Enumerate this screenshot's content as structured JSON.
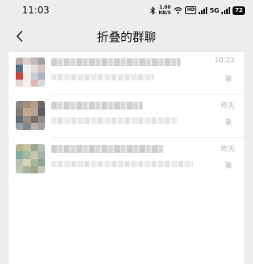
{
  "status_bar": {
    "time": "11:03",
    "net_speed_value": "1.00",
    "net_speed_unit": "KB/S",
    "hd_label": "HD",
    "signal_label": "5G",
    "battery_level": "72"
  },
  "header": {
    "title": "折叠的群聊"
  },
  "chats": [
    {
      "time": "10:22",
      "avatar_colors": [
        "#b9a8a4",
        "#d9d1d0",
        "#c6b6b8",
        "#a2a0a7",
        "#5a6e8a",
        "#f0f0f0",
        "#e2dcdc",
        "#d7c2c2",
        "#d2413b",
        "#f3eded",
        "#c9ccd3",
        "#a9b4c2",
        "#e1d7d6",
        "#f4f0ef",
        "#e3b7b6",
        "#d7d9e0"
      ]
    },
    {
      "time": "昨天",
      "avatar_colors": [
        "#8f8a86",
        "#a3907d",
        "#b49f8a",
        "#6d6a6c",
        "#7f7c7a",
        "#c9a78f",
        "#b8a39a",
        "#5e5d61",
        "#5f6e78",
        "#9a8e82",
        "#7e6f64",
        "#8d8d8f",
        "#9b9fa4",
        "#7e8a93",
        "#bcb2aa",
        "#a7a09a"
      ]
    },
    {
      "time": "昨天",
      "avatar_colors": [
        "#b9b28a",
        "#c7c19f",
        "#9ea791",
        "#b4c0b4",
        "#7fae9f",
        "#a6b9a0",
        "#ccc6a8",
        "#9fb4ad",
        "#b7c6b2",
        "#d8d2b6",
        "#a8b89a",
        "#8fa58e",
        "#c1c5b3",
        "#aab49b",
        "#9aa890",
        "#c4c7b8"
      ]
    }
  ],
  "icons": {
    "back": "chevron-left-icon",
    "mute": "bell-off-icon",
    "bluetooth": "bluetooth-icon",
    "wifi": "wifi-icon"
  }
}
